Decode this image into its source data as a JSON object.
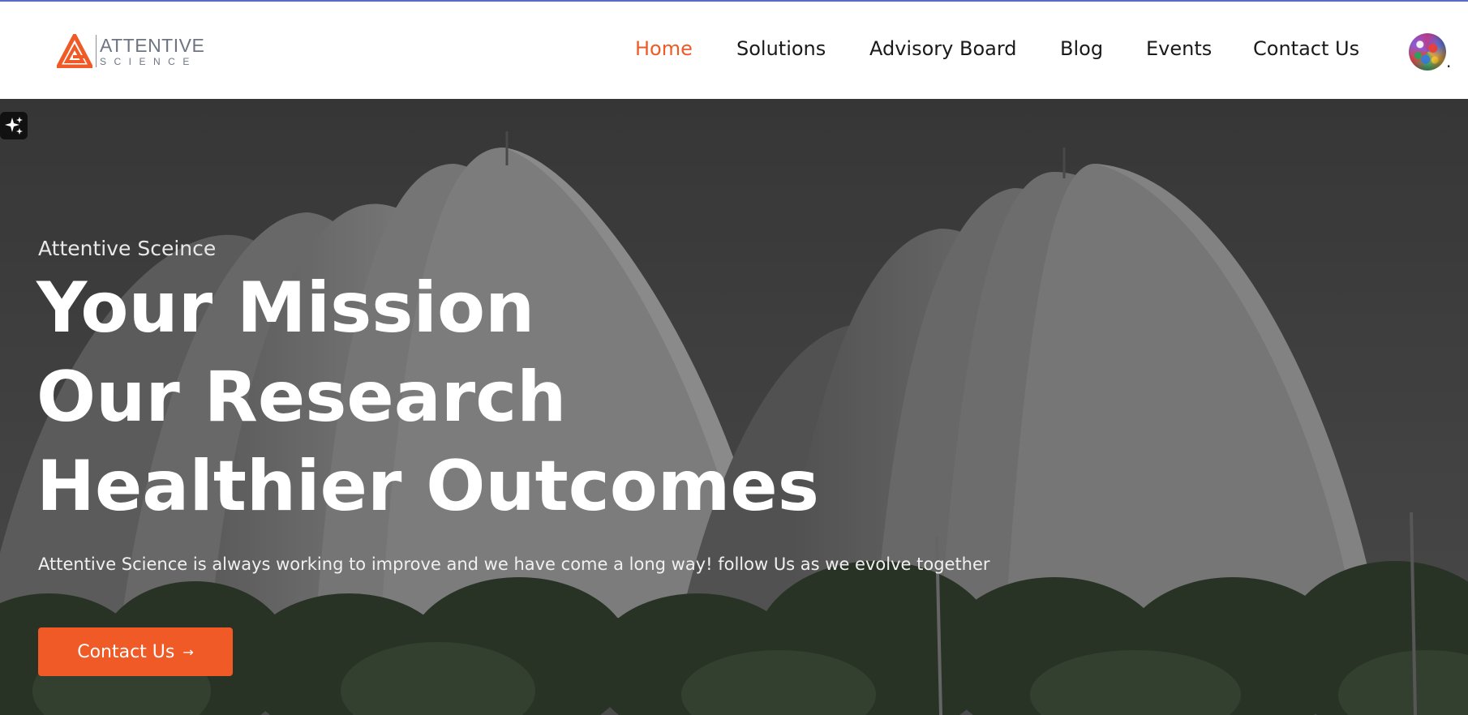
{
  "brand": {
    "name_top": "ATTENTIVE",
    "name_bottom": "SCIENCE",
    "accent": "#ef5a26"
  },
  "nav": {
    "items": [
      {
        "label": "Home",
        "active": true
      },
      {
        "label": "Solutions",
        "active": false
      },
      {
        "label": "Advisory Board",
        "active": false
      },
      {
        "label": "Blog",
        "active": false
      },
      {
        "label": "Events",
        "active": false
      },
      {
        "label": "Contact Us",
        "active": false
      }
    ],
    "language_icon": "globe-icon",
    "language_suffix": "."
  },
  "hero": {
    "eyebrow": "Attentive Sceince",
    "headline_lines": [
      "Your Mission",
      "Our Research",
      "Healthier Outcomes"
    ],
    "subtext": "Attentive Science is always working to improve and we have come a long way! follow Us as we evolve together",
    "cta_label": "Contact Us",
    "cta_icon": "arrow-right-icon",
    "ai_icon": "sparkle-icon"
  }
}
